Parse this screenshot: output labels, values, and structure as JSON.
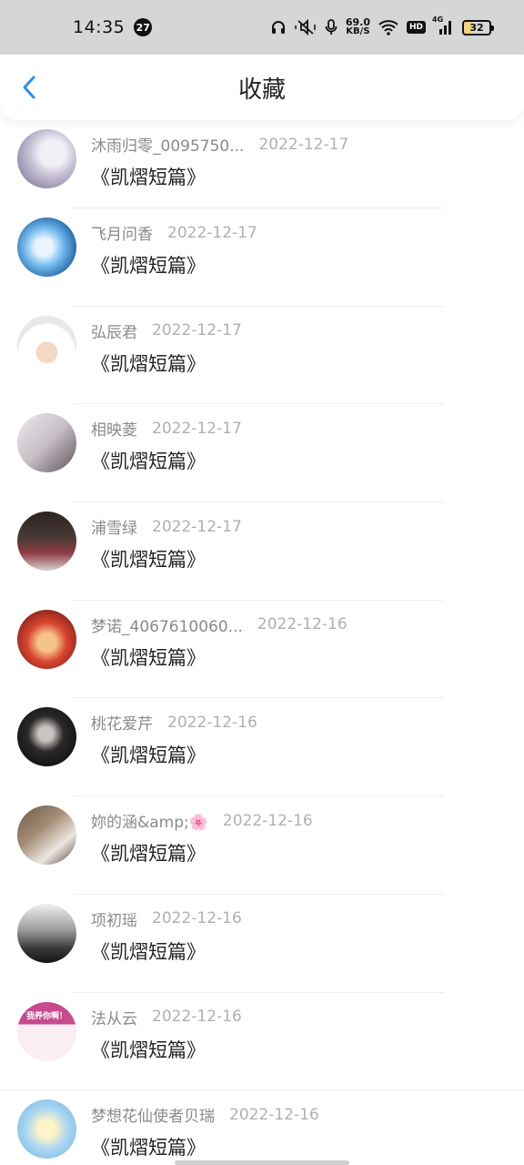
{
  "status_bar": {
    "time": "14:35",
    "notification_count": "27",
    "net_speed_value": "69.0",
    "net_speed_unit": "KB/S",
    "hd_label": "HD",
    "signal_label": "4G",
    "battery": "32"
  },
  "header": {
    "title": "收藏"
  },
  "items": [
    {
      "author": "沐雨归零_0095750...",
      "date": "2022-12-17",
      "book": "《凯熠短篇》"
    },
    {
      "author": "飞月问香",
      "date": "2022-12-17",
      "book": "《凯熠短篇》"
    },
    {
      "author": "弘辰君",
      "date": "2022-12-17",
      "book": "《凯熠短篇》"
    },
    {
      "author": "相映菱",
      "date": "2022-12-17",
      "book": "《凯熠短篇》"
    },
    {
      "author": "浦雪绿",
      "date": "2022-12-17",
      "book": "《凯熠短篇》"
    },
    {
      "author": "梦诺_4067610060...",
      "date": "2022-12-16",
      "book": "《凯熠短篇》"
    },
    {
      "author": "桃花爱芹",
      "date": "2022-12-16",
      "book": "《凯熠短篇》"
    },
    {
      "author": "妳的涵&amp;🌸",
      "date": "2022-12-16",
      "book": "《凯熠短篇》"
    },
    {
      "author": "项初瑶",
      "date": "2022-12-16",
      "book": "《凯熠短篇》"
    },
    {
      "author": "法从云",
      "date": "2022-12-16",
      "book": "《凯熠短篇》",
      "avatar_text": "我养你啊！"
    },
    {
      "author": "梦想花仙使者贝瑞",
      "date": "2022-12-16",
      "book": "《凯熠短篇》"
    }
  ],
  "colors": {
    "accent": "#2a8ff0"
  }
}
